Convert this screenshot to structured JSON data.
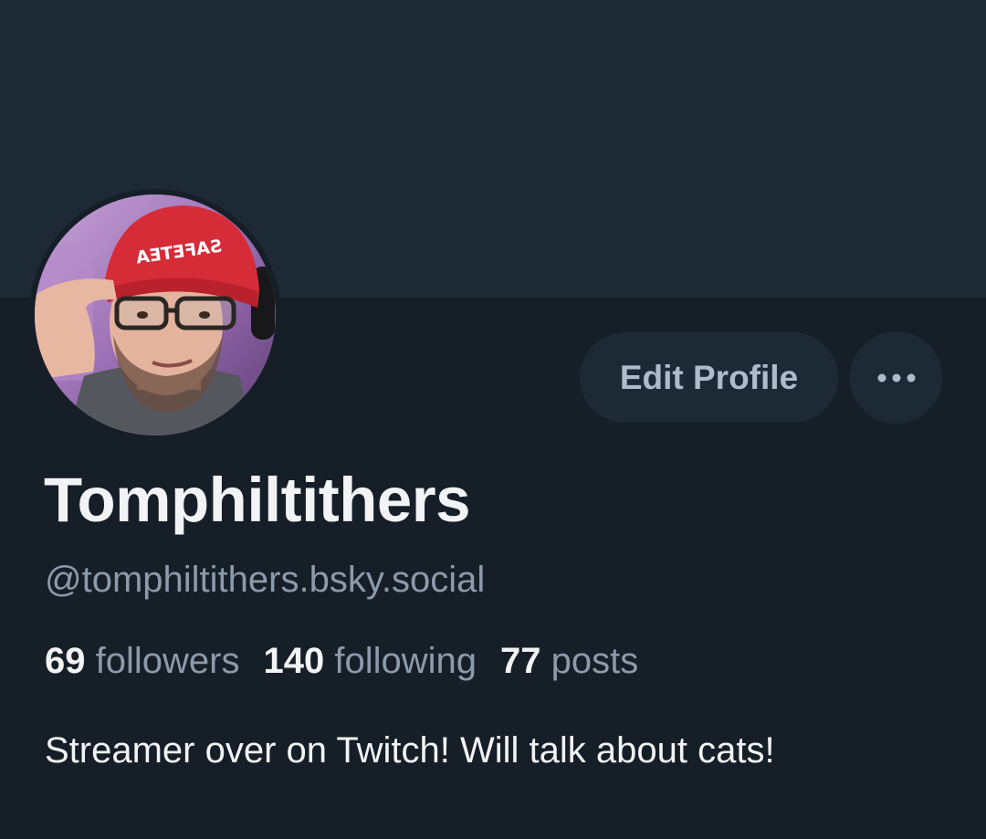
{
  "profile": {
    "display_name": "Tomphiltithers",
    "handle": "@tomphiltithers.bsky.social",
    "bio": "Streamer over on Twitch! Will talk about cats!",
    "avatar_icon": "avatar-photo",
    "beanie_text": "SAFETEA"
  },
  "actions": {
    "edit_label": "Edit Profile",
    "more_label": "•••",
    "more_icon": "ellipsis-icon"
  },
  "stats": [
    {
      "value": "69",
      "label": "followers"
    },
    {
      "value": "140",
      "label": "following"
    },
    {
      "value": "77",
      "label": "posts"
    }
  ],
  "colors": {
    "banner": "#1e2936",
    "background": "#161e27",
    "button_bg": "#1e2936",
    "primary_text": "#f1f3f5",
    "secondary_text": "#8d9aaa"
  }
}
